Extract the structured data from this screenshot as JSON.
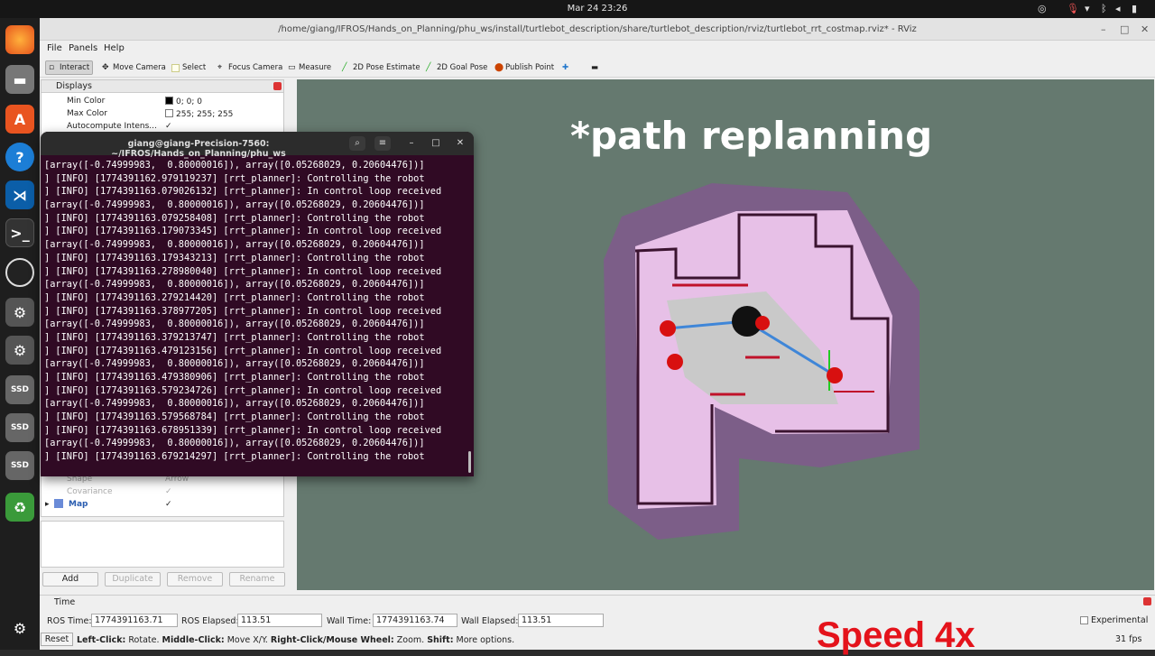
{
  "topbar": {
    "clock": "Mar 24  23:26"
  },
  "window": {
    "title": "/home/giang/IFROS/Hands_on_Planning/phu_ws/install/turtlebot_description/share/turtlebot_description/rviz/turtlebot_rrt_costmap.rviz* - RViz"
  },
  "menu": {
    "file": "File",
    "panels": "Panels",
    "help": "Help"
  },
  "toolbar": {
    "interact": "Interact",
    "move_camera": "Move Camera",
    "select": "Select",
    "focus_camera": "Focus Camera",
    "measure": "Measure",
    "pose_estimate": "2D Pose Estimate",
    "goal_pose": "2D Goal Pose",
    "publish_point": "Publish Point"
  },
  "displays": {
    "title": "Displays",
    "props": [
      {
        "name": "Min Color",
        "value": "0; 0; 0",
        "color": "#000000"
      },
      {
        "name": "Max Color",
        "value": "255; 255; 255",
        "color": "#ffffff"
      },
      {
        "name": "Autocompute Intens...",
        "value": "✓"
      }
    ],
    "lower": [
      {
        "name": "Shape",
        "value": "Arrow"
      },
      {
        "name": "Covariance",
        "value": "✓"
      },
      {
        "name": "Map",
        "value": "✓"
      }
    ]
  },
  "panel_buttons": {
    "add": "Add",
    "duplicate": "Duplicate",
    "remove": "Remove",
    "rename": "Rename"
  },
  "overlay": {
    "title": "*path replanning",
    "speed": "Speed 4x"
  },
  "terminal": {
    "title": "giang@giang-Precision-7560: ~/IFROS/Hands_on_Planning/phu_ws",
    "lines": [
      "[array([-0.74999983,  0.80000016]), array([0.05268029, 0.20604476])]",
      "] [INFO] [1774391162.979119237] [rrt_planner]: Controlling the robot",
      "] [INFO] [1774391163.079026132] [rrt_planner]: In control loop received",
      "[array([-0.74999983,  0.80000016]), array([0.05268029, 0.20604476])]",
      "] [INFO] [1774391163.079258408] [rrt_planner]: Controlling the robot",
      "] [INFO] [1774391163.179073345] [rrt_planner]: In control loop received",
      "[array([-0.74999983,  0.80000016]), array([0.05268029, 0.20604476])]",
      "] [INFO] [1774391163.179343213] [rrt_planner]: Controlling the robot",
      "] [INFO] [1774391163.278980040] [rrt_planner]: In control loop received",
      "[array([-0.74999983,  0.80000016]), array([0.05268029, 0.20604476])]",
      "] [INFO] [1774391163.279214420] [rrt_planner]: Controlling the robot",
      "] [INFO] [1774391163.378977205] [rrt_planner]: In control loop received",
      "[array([-0.74999983,  0.80000016]), array([0.05268029, 0.20604476])]",
      "] [INFO] [1774391163.379213747] [rrt_planner]: Controlling the robot",
      "] [INFO] [1774391163.479123156] [rrt_planner]: In control loop received",
      "[array([-0.74999983,  0.80000016]), array([0.05268029, 0.20604476])]",
      "] [INFO] [1774391163.479380906] [rrt_planner]: Controlling the robot",
      "] [INFO] [1774391163.579234726] [rrt_planner]: In control loop received",
      "[array([-0.74999983,  0.80000016]), array([0.05268029, 0.20604476])]",
      "] [INFO] [1774391163.579568784] [rrt_planner]: Controlling the robot",
      "] [INFO] [1774391163.678951339] [rrt_planner]: In control loop received",
      "[array([-0.74999983,  0.80000016]), array([0.05268029, 0.20604476])]",
      "] [INFO] [1774391163.679214297] [rrt_planner]: Controlling the robot"
    ]
  },
  "time": {
    "title": "Time",
    "ros_time_label": "ROS Time:",
    "ros_time": "1774391163.71",
    "ros_elapsed_label": "ROS Elapsed:",
    "ros_elapsed": "113.51",
    "wall_time_label": "Wall Time:",
    "wall_time": "1774391163.74",
    "wall_elapsed_label": "Wall Elapsed:",
    "wall_elapsed": "113.51",
    "experimental": "Experimental",
    "reset": "Reset",
    "hint_left": "Left-Click:",
    "hint_left_t": " Rotate. ",
    "hint_mid": "Middle-Click:",
    "hint_mid_t": " Move X/Y. ",
    "hint_right": "Right-Click/Mouse Wheel:",
    "hint_right_t": " Zoom. ",
    "hint_shift": "Shift:",
    "hint_shift_t": " More options.",
    "fps": "31 fps"
  }
}
